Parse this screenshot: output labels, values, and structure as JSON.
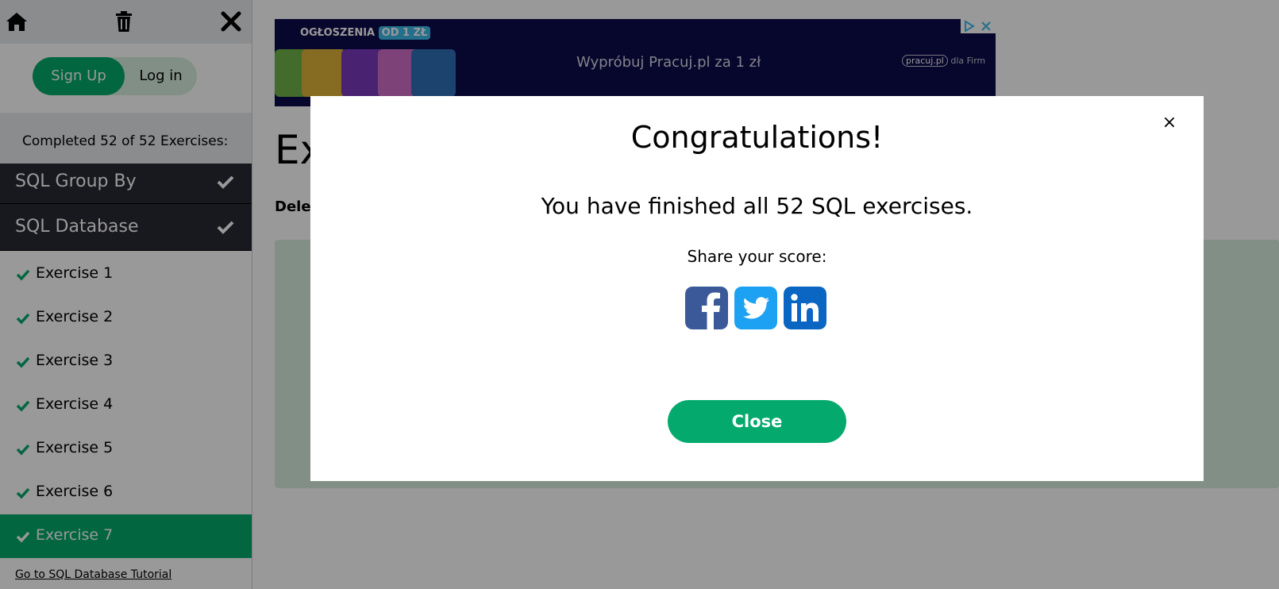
{
  "sidebar": {
    "auth": {
      "signup_label": "Sign Up",
      "login_label": "Log in"
    },
    "progress_text": "Completed 52 of 52 Exercises:",
    "categories": [
      {
        "label": "SQL Group By",
        "completed": true
      },
      {
        "label": "SQL Database",
        "completed": true
      }
    ],
    "exercises": [
      {
        "label": "Exercise 1",
        "completed": true
      },
      {
        "label": "Exercise 2",
        "completed": true
      },
      {
        "label": "Exercise 3",
        "completed": true
      },
      {
        "label": "Exercise 4",
        "completed": true
      },
      {
        "label": "Exercise 5",
        "completed": true
      },
      {
        "label": "Exercise 6",
        "completed": true
      },
      {
        "label": "Exercise 7",
        "completed": true,
        "active": true
      }
    ],
    "tutorial_link": "Go to SQL Database Tutorial"
  },
  "ad": {
    "badge_prefix": "OGŁOSZENIA",
    "badge_highlight": "OD 1 ZŁ",
    "text": "Wypróbuj Pracuj.pl za 1 zł",
    "brand": "pracuj.pl",
    "brand_suffix": "dla Firm"
  },
  "main": {
    "title": "Ex",
    "description": "Delet"
  },
  "modal": {
    "title": "Congratulations!",
    "message": "You have finished all 52 SQL exercises.",
    "share_label": "Share your score:",
    "close_label": "Close",
    "share_icons": [
      "facebook-icon",
      "twitter-icon",
      "linkedin-icon"
    ]
  },
  "colors": {
    "accent_green": "#04aa6d",
    "sidebar_dark": "#282a35",
    "light_green": "#d9eee1",
    "facebook": "#3b5998",
    "twitter": "#1da1f2",
    "linkedin": "#0a66c2"
  }
}
